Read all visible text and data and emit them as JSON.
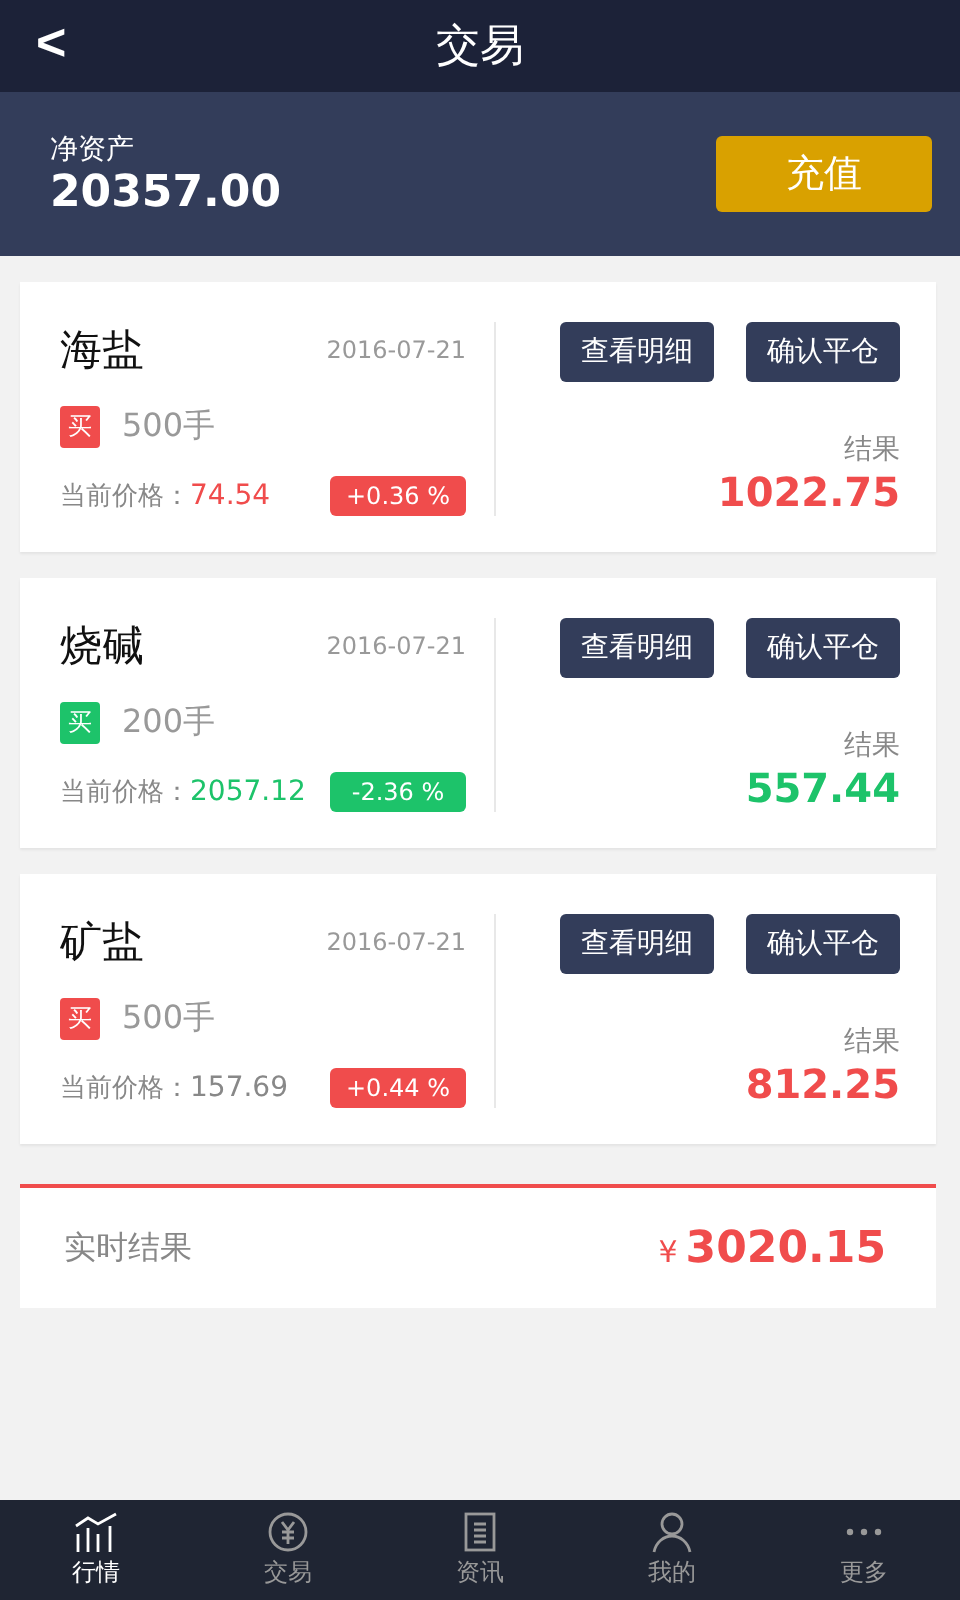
{
  "header": {
    "back": "<",
    "title": "交易"
  },
  "account": {
    "label": "净资产",
    "value": "20357.00",
    "button": "充值"
  },
  "trades": [
    {
      "name": "海盐",
      "date": "2016-07-21",
      "tag": {
        "label": "买",
        "color": "#f04c4c"
      },
      "lots": "500手",
      "price_label": "当前价格：",
      "price": {
        "text": "74.54",
        "color": "#f04c4c"
      },
      "change": {
        "text": "+0.36 %",
        "color": "#f04c4c"
      },
      "buttons": [
        "查看明细",
        "确认平仓"
      ],
      "result_label": "结果",
      "result": {
        "text": "1022.75",
        "color": "#f04c4c"
      }
    },
    {
      "name": "烧碱",
      "date": "2016-07-21",
      "tag": {
        "label": "买",
        "color": "#1dc36a"
      },
      "lots": "200手",
      "price_label": "当前价格：",
      "price": {
        "text": "2057.12",
        "color": "#1dc36a"
      },
      "change": {
        "text": "-2.36 %",
        "color": "#1dc36a"
      },
      "buttons": [
        "查看明细",
        "确认平仓"
      ],
      "result_label": "结果",
      "result": {
        "text": "557.44",
        "color": "#1dc36a"
      }
    },
    {
      "name": "矿盐",
      "date": "2016-07-21",
      "tag": {
        "label": "买",
        "color": "#f04c4c"
      },
      "lots": "500手",
      "price_label": "当前价格：",
      "price": {
        "text": "157.69",
        "color": "#888888"
      },
      "change": {
        "text": "+0.44 %",
        "color": "#f04c4c"
      },
      "buttons": [
        "查看明细",
        "确认平仓"
      ],
      "result_label": "结果",
      "result": {
        "text": "812.25",
        "color": "#f04c4c"
      }
    }
  ],
  "total": {
    "label": "实时结果",
    "currency": "¥",
    "value": "3020.15"
  },
  "nav": [
    {
      "label": "行情",
      "selected": true
    },
    {
      "label": "交易",
      "selected": false
    },
    {
      "label": "资讯",
      "selected": false
    },
    {
      "label": "我的",
      "selected": false
    },
    {
      "label": "更多",
      "selected": false
    }
  ]
}
